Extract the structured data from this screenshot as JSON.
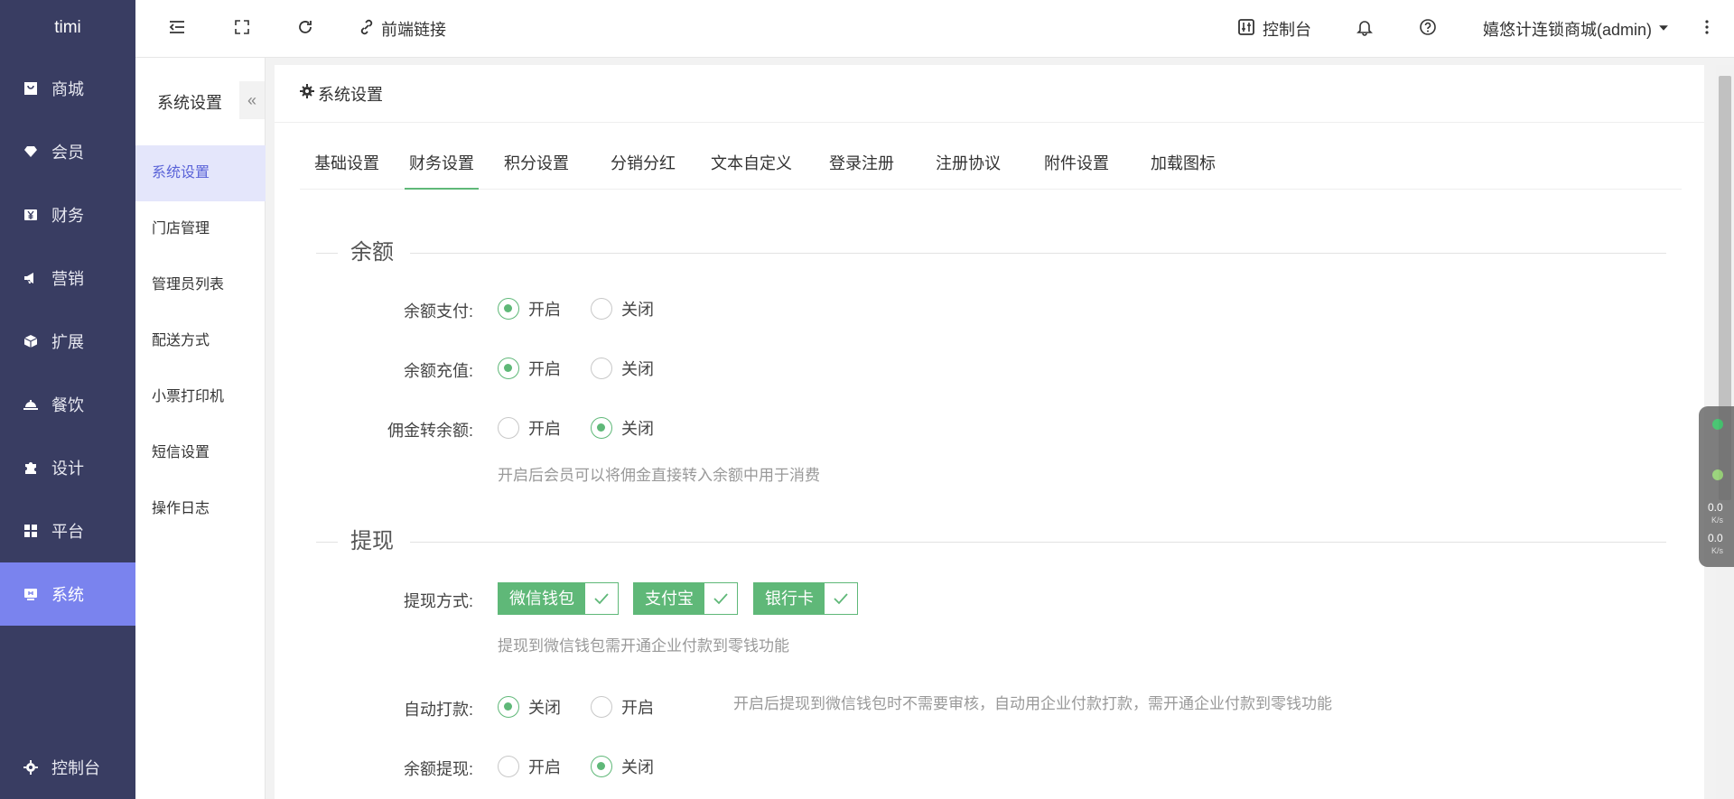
{
  "app": {
    "logo": "timi"
  },
  "sidebar": {
    "items": [
      {
        "label": "商城",
        "icon": "shop-bag-icon"
      },
      {
        "label": "会员",
        "icon": "gem-icon"
      },
      {
        "label": "财务",
        "icon": "yen-icon"
      },
      {
        "label": "营销",
        "icon": "megaphone-icon"
      },
      {
        "label": "扩展",
        "icon": "cube-icon"
      },
      {
        "label": "餐饮",
        "icon": "dish-cloche-icon"
      },
      {
        "label": "设计",
        "icon": "puzzle-icon"
      },
      {
        "label": "平台",
        "icon": "grid-icon"
      },
      {
        "label": "系统",
        "icon": "system-icon",
        "active": true
      }
    ],
    "bottom": {
      "label": "控制台",
      "icon": "gear-icon"
    }
  },
  "topbar": {
    "frontend_link": "前端链接",
    "console": "控制台",
    "user": "嬉悠计连锁商城(admin)"
  },
  "subnav": {
    "title": "系统设置",
    "items": [
      "系统设置",
      "门店管理",
      "管理员列表",
      "配送方式",
      "小票打印机",
      "短信设置",
      "操作日志"
    ]
  },
  "panel": {
    "title": "系统设置",
    "tabs": [
      "基础设置",
      "财务设置",
      "积分设置",
      "分销分红",
      "文本自定义",
      "登录注册",
      "注册协议",
      "附件设置",
      "加载图标"
    ],
    "active_tab": "财务设置",
    "balance": {
      "title": "余额",
      "pay": {
        "label": "余额支付:",
        "opt1": "开启",
        "opt2": "关闭",
        "selected": "开启"
      },
      "recharge": {
        "label": "余额充值:",
        "opt1": "开启",
        "opt2": "关闭",
        "selected": "开启"
      },
      "commission": {
        "label": "佣金转余额:",
        "opt1": "开启",
        "opt2": "关闭",
        "selected": "关闭"
      },
      "commission_hint": "开启后会员可以将佣金直接转入余额中用于消费"
    },
    "withdraw": {
      "title": "提现",
      "method_label": "提现方式:",
      "methods": [
        "微信钱包",
        "支付宝",
        "银行卡"
      ],
      "method_hint": "提现到微信钱包需开通企业付款到零钱功能",
      "auto": {
        "label": "自动打款:",
        "opt1": "关闭",
        "opt2": "开启",
        "selected": "关闭"
      },
      "auto_hint": "开启后提现到微信钱包时不需要审核，自动用企业付款打款，需开通企业付款到零钱功能",
      "balance_withdraw": {
        "label": "余额提现:",
        "opt1": "开启",
        "opt2": "关闭",
        "selected": "关闭"
      }
    }
  },
  "net_widget": {
    "up": "0.0",
    "down": "0.0",
    "unit": "K/s"
  },
  "colors": {
    "sidebar": "#393d62",
    "sidebar_active": "#7a83ee",
    "accent": "#5fb878",
    "sub_active": "#5a63d8"
  }
}
